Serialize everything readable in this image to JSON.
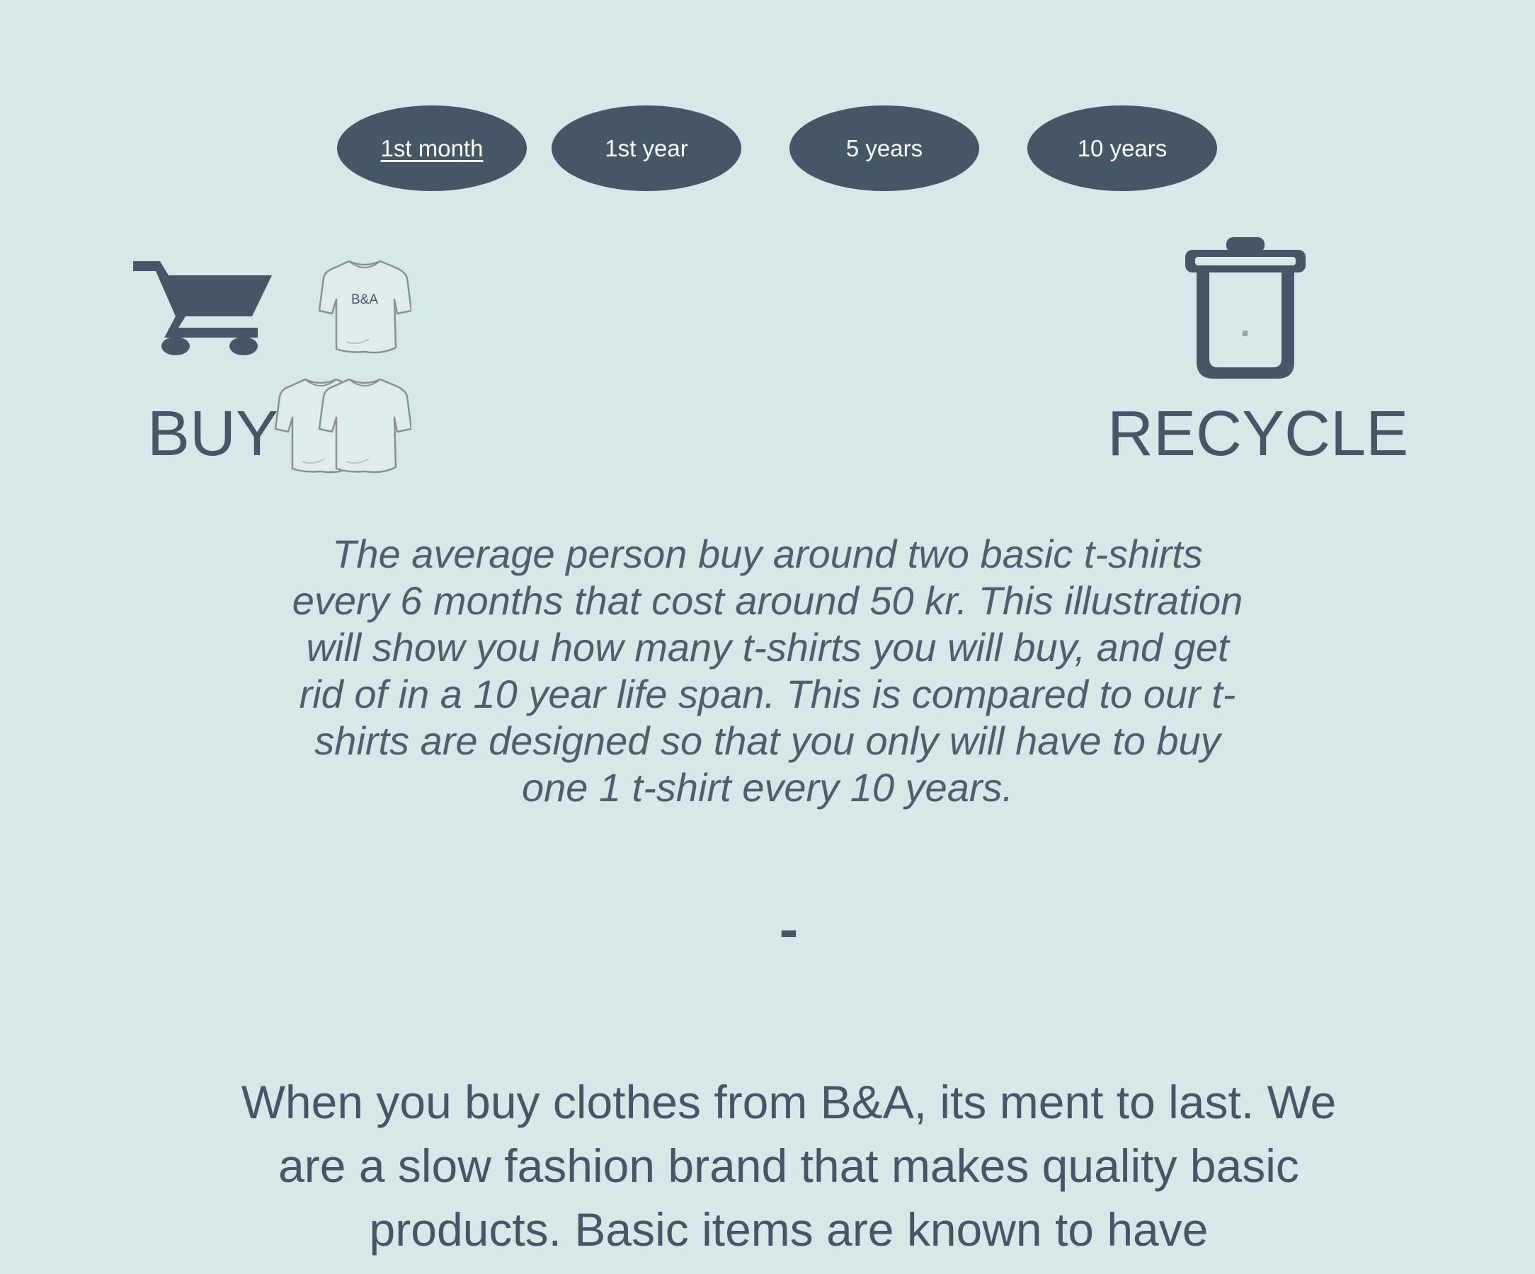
{
  "tabs": [
    {
      "label": "1st month",
      "active": true
    },
    {
      "label": "1st year",
      "active": false
    },
    {
      "label": "5 years",
      "active": false
    },
    {
      "label": "10 years",
      "active": false
    }
  ],
  "buy": {
    "label": "BUY",
    "icon": "shopping-cart-icon"
  },
  "recycle": {
    "label": "RECYCLE",
    "icon": "trash-bin-icon"
  },
  "shirt": {
    "brand_text": "B&A",
    "icon": "t-shirt-icon"
  },
  "intro_text": "The average person buy around two basic t-shirts every 6 months that cost around 50 kr. This illustration will  show you how many t-shirts you will buy, and get rid of in a 10 year life span. This is compared to our t-shirts are designed so that you only will have to buy one 1 t-shirt every 10 years.",
  "counter_text": "-",
  "statement_text": "When you buy clothes from B&A, its ment to last. We are a slow fashion brand that makes quality basic products. Basic items are known to have",
  "colors": {
    "background": "#d5e9e8",
    "primary": "#435766",
    "tab_text": "#ffffff",
    "shirt_fill": "#dfeceb",
    "shirt_outline": "#8a8f94"
  }
}
